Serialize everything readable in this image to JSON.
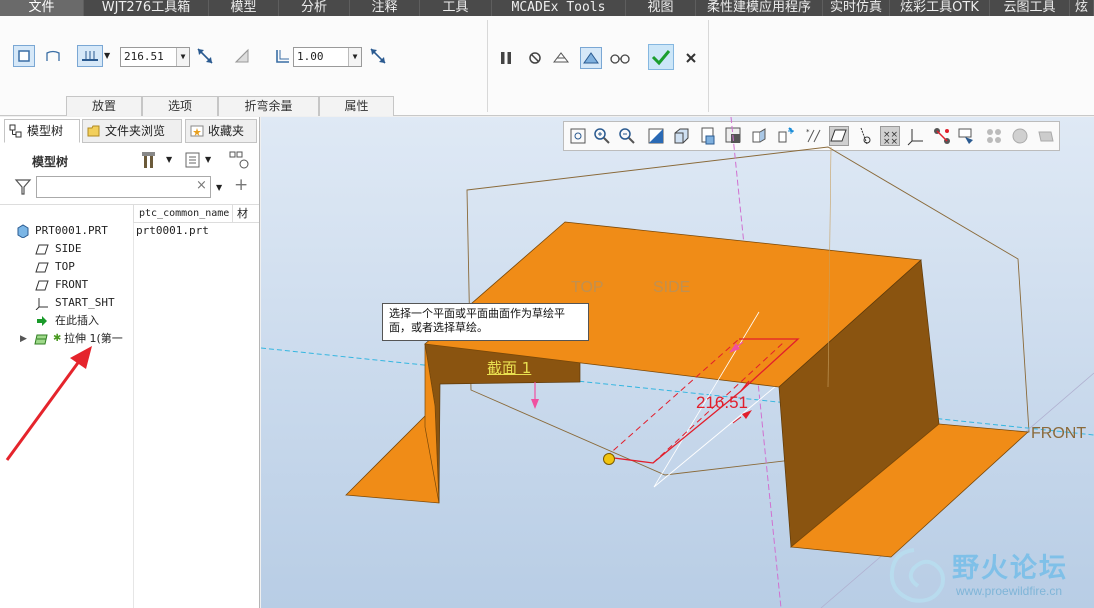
{
  "menu": {
    "tabs": [
      "文件",
      "WJT276工具箱",
      "模型",
      "分析",
      "注释",
      "工具",
      "MCADEx Tools",
      "视图",
      "柔性建模应用程序",
      "实时仿真",
      "炫彩工具OTK",
      "云图工具",
      "炫"
    ]
  },
  "ribbon": {
    "thickness_value": "216.51",
    "second_value": "1.00",
    "group_tabs": [
      "放置",
      "选项",
      "折弯余量",
      "属性"
    ]
  },
  "panel": {
    "tabs": [
      "模型树",
      "文件夹浏览",
      "收藏夹"
    ],
    "title": "模型树",
    "search_placeholder": "",
    "column_header": "ptc_common_name",
    "column_header2": "材",
    "items": [
      {
        "label": "PRT0001.PRT",
        "value": "prt0001.prt",
        "icon": "part-icon"
      },
      {
        "label": "SIDE",
        "icon": "datum-plane-icon"
      },
      {
        "label": "TOP",
        "icon": "datum-plane-icon"
      },
      {
        "label": "FRONT",
        "icon": "datum-plane-icon"
      },
      {
        "label": "START_SHT",
        "icon": "coordinate-system-icon"
      },
      {
        "label": "在此插入",
        "icon": "insert-here-arrow-icon"
      },
      {
        "label": "拉伸 1(第一",
        "icon": "sheetmetal-extrude-icon"
      }
    ]
  },
  "viewport": {
    "tooltip": "选择一个平面或平面曲面作为草绘平面，或者选择草绘。",
    "plane_labels": {
      "top": "TOP",
      "side": "SIDE",
      "front": "FRONT"
    },
    "section_label": "截面 1",
    "dimension": "216.51",
    "watermark_title": "野火论坛",
    "watermark_url": "www.proewildfire.cn"
  },
  "colors": {
    "sheet_top": "#f08c17",
    "sheet_side": "#8a5410",
    "viewport_bg": "#c9d9ec",
    "annotation_red": "#e21e2b"
  }
}
